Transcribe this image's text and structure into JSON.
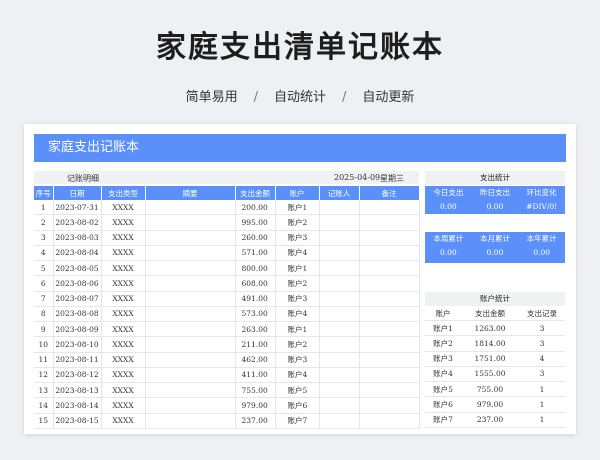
{
  "page": {
    "title": "家庭支出清单记账本",
    "features": [
      "简单易用",
      "自动统计",
      "自动更新"
    ],
    "separator": "/"
  },
  "sheet": {
    "banner": "家庭支出记账本",
    "ledger": {
      "section_label": "记账明细",
      "date": "2025-04-09",
      "weekday": "星期三",
      "columns": [
        "序号",
        "日期",
        "支出类型",
        "摘要",
        "支出金额",
        "账户",
        "记账人",
        "备注"
      ],
      "rows": [
        {
          "no": "1",
          "date": "2023-07-31",
          "type": "XXXX",
          "summary": "",
          "amount": "200.00",
          "account": "账户1",
          "who": "",
          "note": ""
        },
        {
          "no": "2",
          "date": "2023-08-02",
          "type": "XXXX",
          "summary": "",
          "amount": "995.00",
          "account": "账户2",
          "who": "",
          "note": ""
        },
        {
          "no": "3",
          "date": "2023-08-03",
          "type": "XXXX",
          "summary": "",
          "amount": "260.00",
          "account": "账户3",
          "who": "",
          "note": ""
        },
        {
          "no": "4",
          "date": "2023-08-04",
          "type": "XXXX",
          "summary": "",
          "amount": "571.00",
          "account": "账户4",
          "who": "",
          "note": ""
        },
        {
          "no": "5",
          "date": "2023-08-05",
          "type": "XXXX",
          "summary": "",
          "amount": "800.00",
          "account": "账户1",
          "who": "",
          "note": ""
        },
        {
          "no": "6",
          "date": "2023-08-06",
          "type": "XXXX",
          "summary": "",
          "amount": "608.00",
          "account": "账户2",
          "who": "",
          "note": ""
        },
        {
          "no": "7",
          "date": "2023-08-07",
          "type": "XXXX",
          "summary": "",
          "amount": "491.00",
          "account": "账户3",
          "who": "",
          "note": ""
        },
        {
          "no": "8",
          "date": "2023-08-08",
          "type": "XXXX",
          "summary": "",
          "amount": "573.00",
          "account": "账户4",
          "who": "",
          "note": ""
        },
        {
          "no": "9",
          "date": "2023-08-09",
          "type": "XXXX",
          "summary": "",
          "amount": "263.00",
          "account": "账户1",
          "who": "",
          "note": ""
        },
        {
          "no": "10",
          "date": "2023-08-10",
          "type": "XXXX",
          "summary": "",
          "amount": "211.00",
          "account": "账户2",
          "who": "",
          "note": ""
        },
        {
          "no": "11",
          "date": "2023-08-11",
          "type": "XXXX",
          "summary": "",
          "amount": "462.00",
          "account": "账户3",
          "who": "",
          "note": ""
        },
        {
          "no": "12",
          "date": "2023-08-12",
          "type": "XXXX",
          "summary": "",
          "amount": "411.00",
          "account": "账户4",
          "who": "",
          "note": ""
        },
        {
          "no": "13",
          "date": "2023-08-13",
          "type": "XXXX",
          "summary": "",
          "amount": "755.00",
          "account": "账户5",
          "who": "",
          "note": ""
        },
        {
          "no": "14",
          "date": "2023-08-14",
          "type": "XXXX",
          "summary": "",
          "amount": "979.00",
          "account": "账户6",
          "who": "",
          "note": ""
        },
        {
          "no": "15",
          "date": "2023-08-15",
          "type": "XXXX",
          "summary": "",
          "amount": "237.00",
          "account": "账户7",
          "who": "",
          "note": ""
        }
      ]
    },
    "stats": {
      "title": "支出统计",
      "top": {
        "labels": [
          "今日支出",
          "昨日支出",
          "环比变化"
        ],
        "values": [
          "0.00",
          "0.00",
          "#DIV/0!"
        ]
      },
      "period": {
        "labels": [
          "本周累计",
          "本月累计",
          "本年累计"
        ],
        "values": [
          "0.00",
          "0.00",
          "0.00"
        ]
      }
    },
    "accounts": {
      "title": "账户统计",
      "columns": [
        "账户",
        "支出金额",
        "支出记录"
      ],
      "rows": [
        {
          "account": "账户1",
          "amount": "1263.00",
          "count": "3"
        },
        {
          "account": "账户2",
          "amount": "1814.00",
          "count": "3"
        },
        {
          "account": "账户3",
          "amount": "1751.00",
          "count": "4"
        },
        {
          "account": "账户4",
          "amount": "1555.00",
          "count": "3"
        },
        {
          "account": "账户5",
          "amount": "755.00",
          "count": "1"
        },
        {
          "account": "账户6",
          "amount": "979.00",
          "count": "1"
        },
        {
          "account": "账户7",
          "amount": "237.00",
          "count": "1"
        }
      ]
    }
  }
}
